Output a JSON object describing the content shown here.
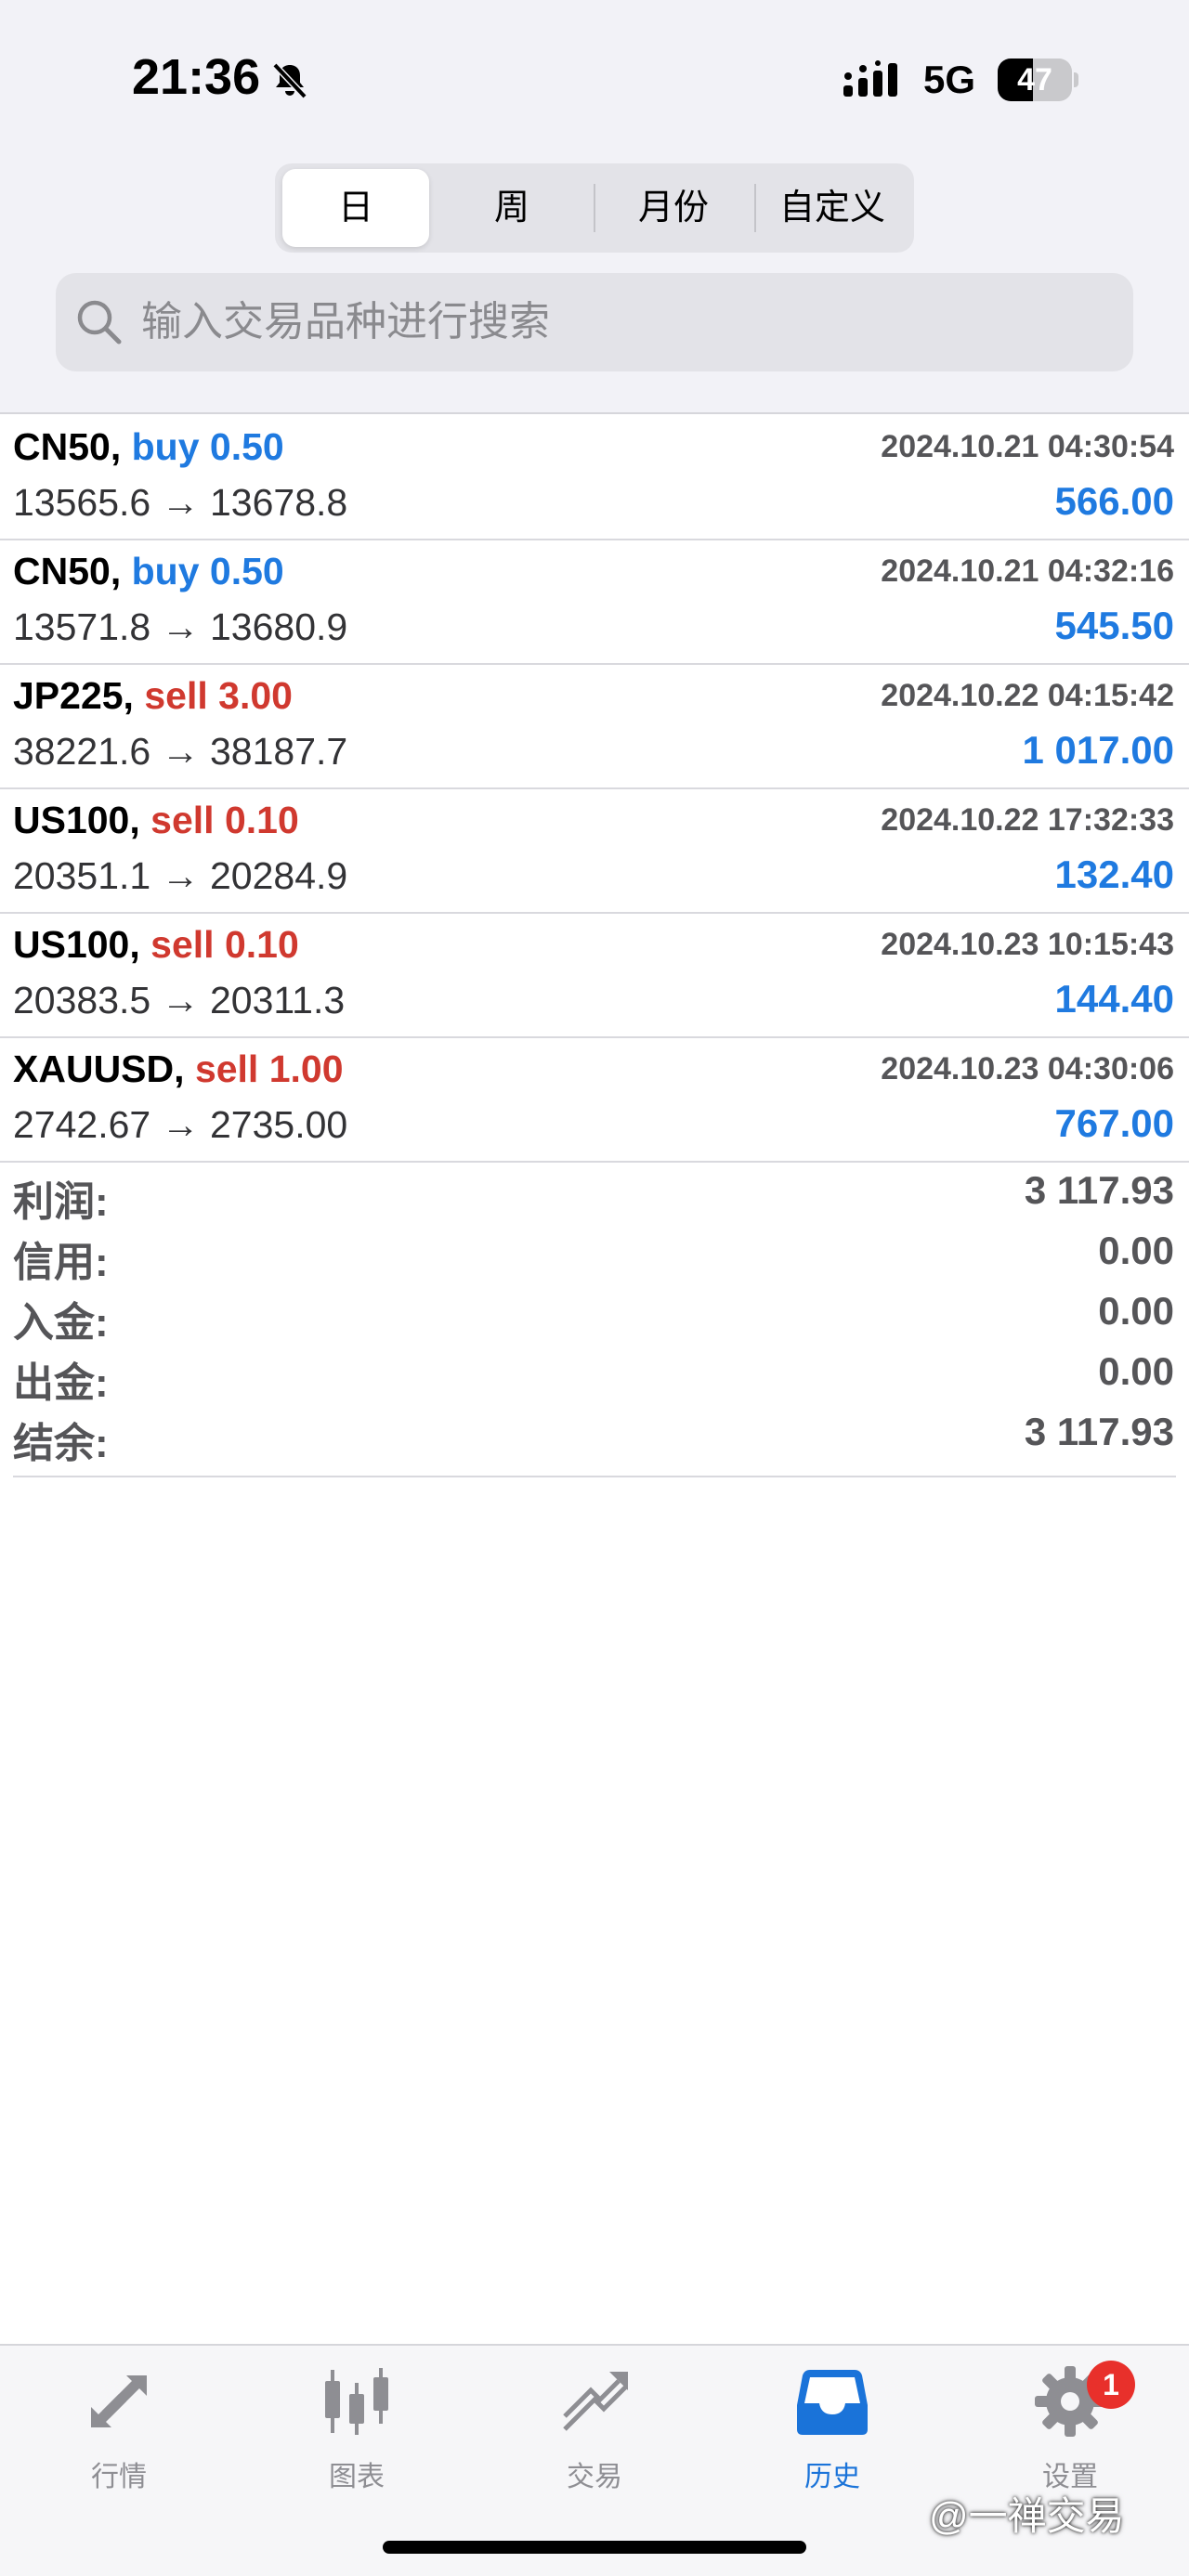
{
  "status_bar": {
    "time": "21:36",
    "network": "5G",
    "battery_level": 47,
    "battery_text": "47"
  },
  "period_tabs": [
    {
      "label": "日",
      "active": true
    },
    {
      "label": "周",
      "active": false
    },
    {
      "label": "月份",
      "active": false
    },
    {
      "label": "自定义",
      "active": false
    }
  ],
  "search": {
    "placeholder": "输入交易品种进行搜索",
    "value": ""
  },
  "trades": [
    {
      "symbol": "CN50,",
      "side": "buy 0.50",
      "side_type": "buy",
      "time": "2024.10.21 04:30:54",
      "prices": "13565.6 → 13678.8",
      "profit": "566.00"
    },
    {
      "symbol": "CN50,",
      "side": "buy 0.50",
      "side_type": "buy",
      "time": "2024.10.21 04:32:16",
      "prices": "13571.8 → 13680.9",
      "profit": "545.50"
    },
    {
      "symbol": "JP225,",
      "side": "sell 3.00",
      "side_type": "sell",
      "time": "2024.10.22 04:15:42",
      "prices": "38221.6 → 38187.7",
      "profit": "1 017.00"
    },
    {
      "symbol": "US100,",
      "side": "sell 0.10",
      "side_type": "sell",
      "time": "2024.10.22 17:32:33",
      "prices": "20351.1 → 20284.9",
      "profit": "132.40"
    },
    {
      "symbol": "US100,",
      "side": "sell 0.10",
      "side_type": "sell",
      "time": "2024.10.23 10:15:43",
      "prices": "20383.5 → 20311.3",
      "profit": "144.40"
    },
    {
      "symbol": "XAUUSD,",
      "side": "sell 1.00",
      "side_type": "sell",
      "time": "2024.10.23 04:30:06",
      "prices": "2742.67 → 2735.00",
      "profit": "767.00"
    }
  ],
  "summary": {
    "profit_label": "利润:",
    "profit_value": "3 117.93",
    "credit_label": "信用:",
    "credit_value": "0.00",
    "deposit_label": "入金:",
    "deposit_value": "0.00",
    "withdrawal_label": "出金:",
    "withdrawal_value": "0.00",
    "balance_label": "结余:",
    "balance_value": "3 117.93"
  },
  "tab_bar": {
    "quotes": "行情",
    "charts": "图表",
    "trade": "交易",
    "history": "历史",
    "settings": "设置",
    "settings_badge": "1",
    "active": "history"
  },
  "colors": {
    "buy": "#1f7ae0",
    "sell": "#d0392f",
    "profit": "#1f7ae0",
    "active_tab": "#1a73d9",
    "badge": "#e8302b"
  },
  "watermark": "@一禅交易"
}
